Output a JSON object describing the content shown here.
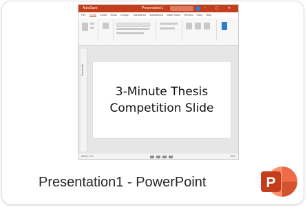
{
  "window": {
    "label": "Presentation1 - PowerPoint",
    "app_icon": "powerpoint-icon",
    "app_icon_letter": "P"
  },
  "thumbnail": {
    "titlebar": {
      "autosave": "AutoSave",
      "document_name": "Presentation1",
      "controls": "– ▢ ✕"
    },
    "menu_tabs": [
      "File",
      "Home",
      "Insert",
      "Draw",
      "Design",
      "Transitions",
      "Animations",
      "Slide Show",
      "Review",
      "View",
      "Help"
    ],
    "side_pane_label": "Thumbnails",
    "slide_text": "3-Minute Thesis Competition Slide",
    "status_left": "Slide 1 of 1",
    "status_zoom": "50%"
  },
  "colors": {
    "accent": "#c43e1c",
    "icon_dark": "#c43e1c",
    "icon_light": "#ff8f6b"
  }
}
